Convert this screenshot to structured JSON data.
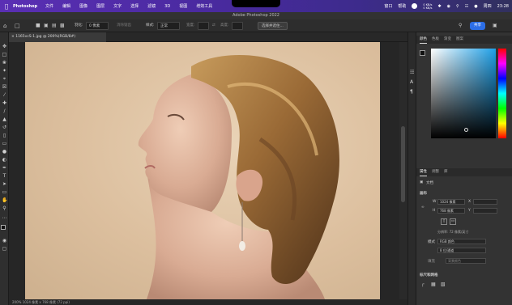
{
  "menubar": {
    "app_name": "Photoshop",
    "items": [
      "文件",
      "编辑",
      "图像",
      "图层",
      "文字",
      "选择",
      "滤镜",
      "3D",
      "视图",
      "增效工具"
    ],
    "right_items": [
      "窗口",
      "帮助"
    ],
    "net_up": "0 KB/s",
    "net_down": "0 KB/s",
    "clock_day": "周四",
    "clock_time": "23:28"
  },
  "window": {
    "title": "Adobe Photoshop 2022"
  },
  "options_bar": {
    "feather_label": "羽化:",
    "feather_value": "0 像素",
    "antialias_label": "消除锯齿",
    "style_label": "样式:",
    "style_value": "正常",
    "width_label": "宽度:",
    "height_label": "高度:",
    "select_mask_button": "选择并遮住...",
    "share_button": "共享"
  },
  "document": {
    "tab_label": "1165vcS-1.jpg @ 200%(RGB/8#)",
    "status": "200%   1024 像素 x 768 像素 (72 ppi)"
  },
  "color_panel": {
    "tabs": [
      "颜色",
      "色板",
      "渐变",
      "图案"
    ]
  },
  "properties_panel": {
    "tabs": [
      "属性",
      "调整",
      "库"
    ],
    "doc_type": "文档",
    "canvas_header": "画布",
    "w_label": "W",
    "w_value": "1024 像素",
    "x_label": "X",
    "h_label": "H",
    "h_value": "768 像素",
    "y_label": "Y",
    "resolution": "分辨率: 72 像素/英寸",
    "mode_label": "模式",
    "mode_value": "RGB 颜色",
    "depth_value": "8 位/通道",
    "fill_label": "填充",
    "fill_value": "背景颜色",
    "ruler_header": "标尺和网格"
  },
  "colors": {
    "accent": "#2c6ee6",
    "menubar": "#5a2fb4",
    "panel_bg": "#333333"
  }
}
